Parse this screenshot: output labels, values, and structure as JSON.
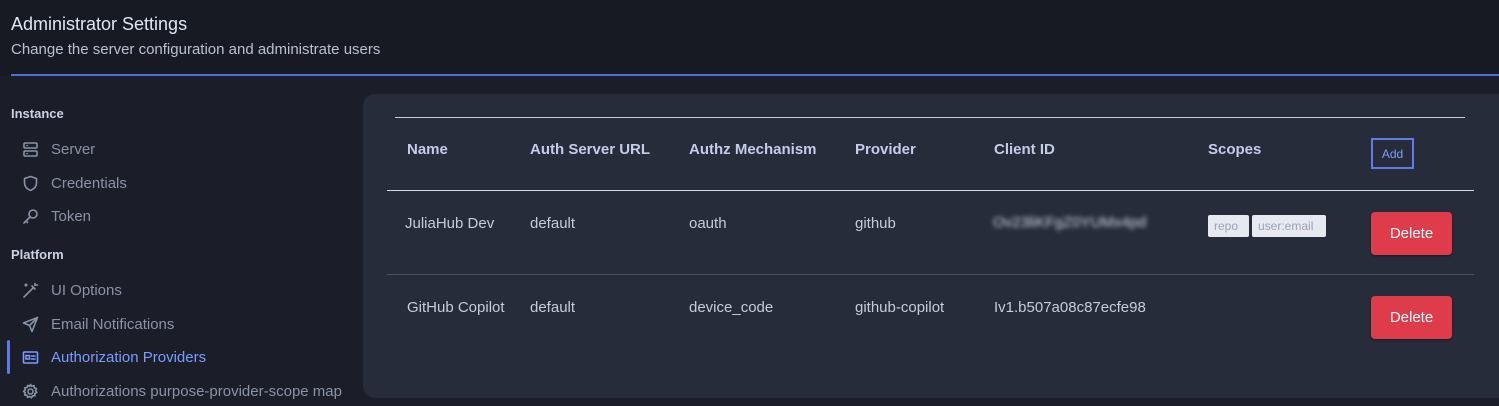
{
  "header": {
    "title": "Administrator Settings",
    "subtitle": "Change the server configuration and administrate users"
  },
  "sidebar": {
    "sections": [
      {
        "title": "Instance",
        "items": [
          {
            "label": "Server",
            "icon": "server-icon"
          },
          {
            "label": "Credentials",
            "icon": "shield-icon"
          },
          {
            "label": "Token",
            "icon": "key-icon"
          }
        ]
      },
      {
        "title": "Platform",
        "items": [
          {
            "label": "UI Options",
            "icon": "magic-wand-icon"
          },
          {
            "label": "Email Notifications",
            "icon": "send-icon"
          },
          {
            "label": "Authorization Providers",
            "icon": "id-card-icon",
            "active": true
          },
          {
            "label": "Authorizations purpose-provider-scope map",
            "icon": "gear-icon"
          }
        ]
      }
    ]
  },
  "table": {
    "columns": [
      "Name",
      "Auth Server URL",
      "Authz Mechanism",
      "Provider",
      "Client ID",
      "Scopes"
    ],
    "add_label": "Add",
    "delete_label": "Delete",
    "rows": [
      {
        "name": "JuliaHub Dev",
        "auth_url": "default",
        "mechanism": "oauth",
        "provider": "github",
        "client_id": "Ov23liKFgZ0YUMx4pd",
        "scopes": [
          "repo",
          "user:email"
        ]
      },
      {
        "name": "GitHub Copilot",
        "auth_url": "default",
        "mechanism": "device_code",
        "provider": "github-copilot",
        "client_id": "Iv1.b507a08c87ecfe98",
        "scopes": []
      }
    ]
  },
  "colors": {
    "accent": "#5b7ce8",
    "delete": "#de3c4b",
    "panel": "#272c3b",
    "background": "#1b1e28"
  }
}
